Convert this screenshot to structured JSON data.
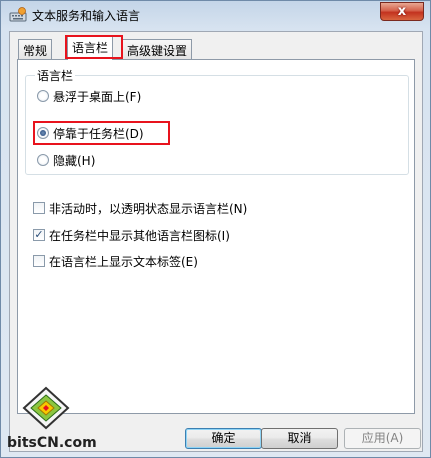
{
  "window": {
    "title": "文本服务和输入语言",
    "close_label": "x"
  },
  "tabs": [
    {
      "label": "常规",
      "active": false
    },
    {
      "label": "语言栏",
      "active": true
    },
    {
      "label": "高级键设置",
      "active": false
    }
  ],
  "language_bar_group": {
    "title": "语言栏",
    "options": [
      {
        "label": "悬浮于桌面上(F)",
        "checked": false
      },
      {
        "label": "停靠于任务栏(D)",
        "checked": true
      },
      {
        "label": "隐藏(H)",
        "checked": false
      }
    ]
  },
  "checkboxes": [
    {
      "label": "非活动时，以透明状态显示语言栏(N)",
      "checked": false
    },
    {
      "label": "在任务栏中显示其他语言栏图标(I)",
      "checked": true
    },
    {
      "label": "在语言栏上显示文本标签(E)",
      "checked": false
    }
  ],
  "buttons": {
    "ok": "确定",
    "cancel": "取消",
    "apply": "应用(A)"
  },
  "watermark": {
    "text": "bitsCN.com"
  },
  "colors": {
    "highlight_box": "#e8131d",
    "close_button": "#c3321f"
  }
}
